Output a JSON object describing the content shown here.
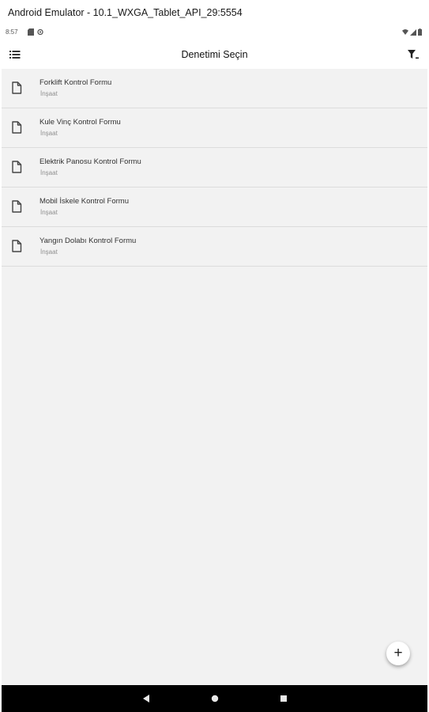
{
  "window": {
    "title": "Android Emulator - 10.1_WXGA_Tablet_API_29:5554"
  },
  "status_bar": {
    "time": "8:57",
    "left_icons": [
      "sd-card-icon",
      "sync-icon"
    ],
    "right_icons": [
      "wifi-icon",
      "signal-icon",
      "battery-icon"
    ]
  },
  "app_bar": {
    "title": "Denetimi Seçin",
    "menu_icon": "list-icon",
    "filter_icon": "filter-icon"
  },
  "forms": [
    {
      "title": "Forklift Kontrol Formu",
      "category": "İnşaat"
    },
    {
      "title": "Kule Vinç Kontrol Formu",
      "category": "İnşaat"
    },
    {
      "title": "Elektrik Panosu Kontrol Formu",
      "category": "İnşaat"
    },
    {
      "title": "Mobil İskele Kontrol Formu",
      "category": "İnşaat"
    },
    {
      "title": "Yangın Dolabı Kontrol Formu",
      "category": "İnşaat"
    }
  ],
  "fab": {
    "label": "+"
  },
  "nav_bar": {
    "buttons": [
      "back-icon",
      "home-icon",
      "recents-icon"
    ]
  },
  "colors": {
    "background": "#f2f2f2",
    "app_bar": "#ffffff",
    "nav_bar": "#000000",
    "divider": "#dcdcdc"
  }
}
